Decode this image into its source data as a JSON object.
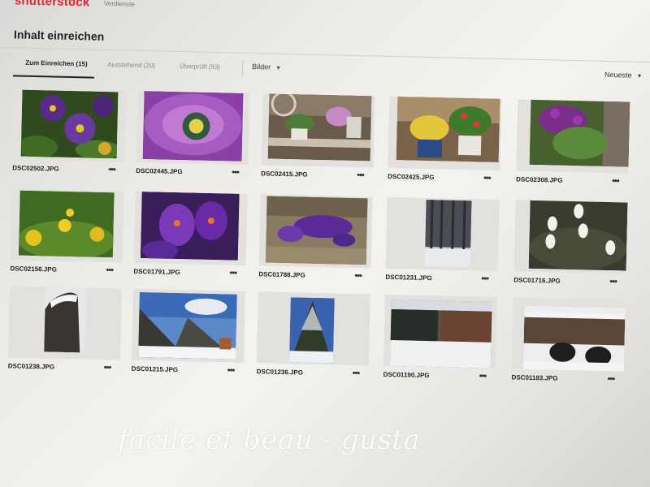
{
  "header": {
    "logo": "shutterstock",
    "logo_sub": "Verdienste"
  },
  "page_title": "Inhalt einreichen",
  "tabs": [
    {
      "label": "Zum Einreichen (15)",
      "active": true
    },
    {
      "label": "Ausstehend (20)",
      "active": false
    },
    {
      "label": "Überprüft (93)",
      "active": false
    }
  ],
  "filter_label": "Bilder",
  "sort_label": "Neueste",
  "files": [
    {
      "name": "DSC02502.JPG",
      "subject": "purple-pansy-flowers"
    },
    {
      "name": "DSC02445.JPG",
      "subject": "purple-daisy-closeup"
    },
    {
      "name": "DSC02415.JPG",
      "subject": "flower-pots-on-table"
    },
    {
      "name": "DSC02425.JPG",
      "subject": "yellow-and-red-potted-flowers"
    },
    {
      "name": "DSC02308.JPG",
      "subject": "purple-flowering-shrub"
    },
    {
      "name": "DSC02156.JPG",
      "subject": "yellow-flowers"
    },
    {
      "name": "DSC01791.JPG",
      "subject": "purple-crocus-closeup"
    },
    {
      "name": "DSC01788.JPG",
      "subject": "purple-crocus-field"
    },
    {
      "name": "DSC01231.JPG",
      "subject": "snowy-forest"
    },
    {
      "name": "DSC01716.JPG",
      "subject": "snowdrop-flowers"
    },
    {
      "name": "DSC01238.JPG",
      "subject": "snowy-tree-trunk"
    },
    {
      "name": "DSC01215.JPG",
      "subject": "snowy-trees-blue-sky"
    },
    {
      "name": "DSC01236.JPG",
      "subject": "snow-covered-fir-tree"
    },
    {
      "name": "DSC01190.JPG",
      "subject": "snowy-garden-with-fence"
    },
    {
      "name": "DSC01183.JPG",
      "subject": "dogs-in-snow"
    }
  ],
  "more_label": "•••",
  "watermark": "facile et beau - gusta"
}
